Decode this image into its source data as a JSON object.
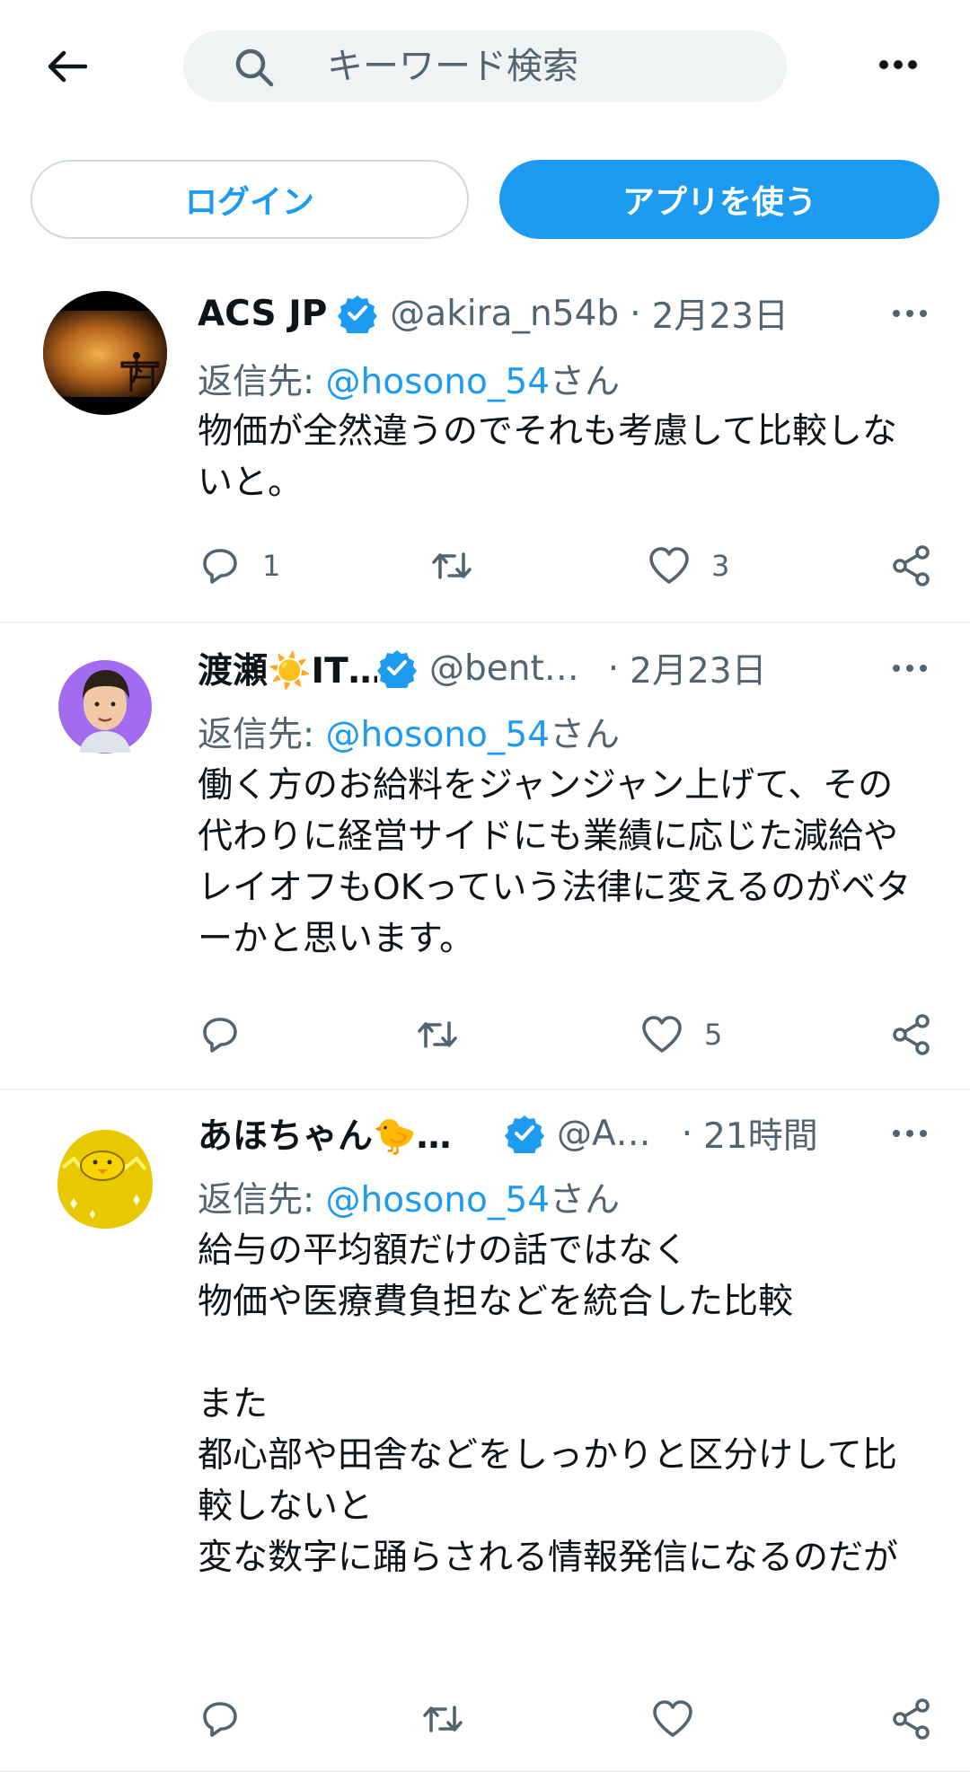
{
  "search": {
    "placeholder": "キーワード検索"
  },
  "auth": {
    "login_label": "ログイン",
    "app_label": "アプリを使う"
  },
  "colors": {
    "accent": "#1d9bf0",
    "text": "#0f1419",
    "secondary": "#536471"
  },
  "tweets": [
    {
      "name": "ACS JP",
      "handle": "@akira_n54b",
      "separator": "·",
      "date": "2月23日",
      "reply_prefix": "返信先: ",
      "reply_mention": "@hosono_54",
      "reply_suffix": "さん",
      "text": "物価が全然違うのでそれも考慮して比較しないと。",
      "replies": "1",
      "retweets": "",
      "likes": "3"
    },
    {
      "name": "渡瀬☀️IT…",
      "handle": "@bent…",
      "separator": "·",
      "date": "2月23日",
      "reply_prefix": "返信先: ",
      "reply_mention": "@hosono_54",
      "reply_suffix": "さん",
      "text": "働く方のお給料をジャンジャン上げて、その代わりに経営サイドにも業績に応じた減給やレイオフもOKっていう法律に変えるのがベターかと思います。",
      "replies": "",
      "retweets": "",
      "likes": "5"
    },
    {
      "name": "あほちゃん🐤…",
      "handle": "@A…",
      "separator": "·",
      "date": "21時間",
      "reply_prefix": "返信先: ",
      "reply_mention": "@hosono_54",
      "reply_suffix": "さん",
      "text": "給与の平均額だけの話ではなく\n物価や医療費負担などを統合した比較\n\nまた\n都心部や田舎などをしっかりと区分けして比較しないと\n変な数字に踊らされる情報発信になるのだが",
      "replies": "",
      "retweets": "",
      "likes": ""
    }
  ]
}
